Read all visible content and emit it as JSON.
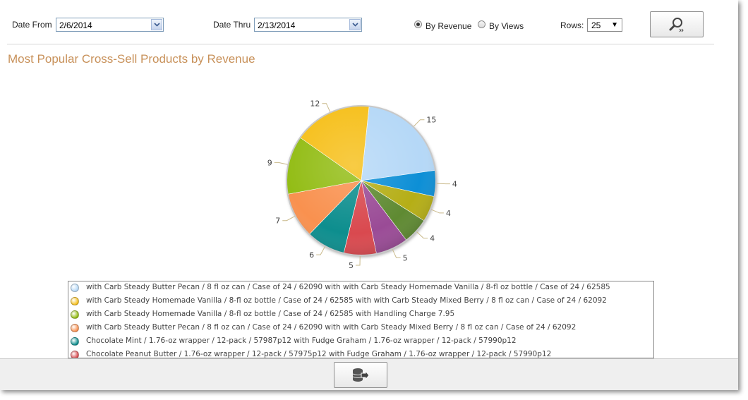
{
  "filters": {
    "date_from_label": "Date From",
    "date_from_value": "2/6/2014",
    "date_thru_label": "Date Thru",
    "date_thru_value": "2/13/2014",
    "by_revenue_label": "By Revenue",
    "by_views_label": "By Views",
    "selected_mode": "By Revenue",
    "rows_label": "Rows:",
    "rows_value": "25"
  },
  "report_title": "Most Popular Cross-Sell Products by Revenue",
  "chart_data": {
    "type": "pie",
    "title": "",
    "values": [
      15,
      4,
      4,
      4,
      5,
      5,
      6,
      7,
      9,
      12
    ],
    "colors": [
      "#b5d8f7",
      "#0f8fd6",
      "#b5ae14",
      "#5f8a31",
      "#9a4c96",
      "#d94a4f",
      "#0e8e8e",
      "#f99150",
      "#93bd12",
      "#f6c01f"
    ],
    "legend": [
      "with Carb Steady Butter Pecan / 8 fl oz can / Case of 24 / 62090 with with Carb Steady Homemade Vanilla / 8-fl oz bottle / Case of 24 / 62585",
      "with Carb Steady Homemade Vanilla / 8-fl oz bottle / Case of 24 / 62585 with with Carb Steady Mixed Berry / 8 fl oz can / Case of 24  / 62092",
      "with Carb Steady Homemade Vanilla / 8-fl oz bottle / Case of 24 / 62585 with Handling Charge 7.95",
      "with Carb Steady Butter Pecan / 8 fl oz can / Case of 24 / 62090 with with Carb Steady Mixed Berry / 8 fl oz can / Case of 24  / 62092",
      "Chocolate Mint / 1.76-oz wrapper / 12-pack / 57987p12 with Fudge Graham / 1.76-oz wrapper / 12-pack / 57990p12",
      "Chocolate Peanut Butter / 1.76-oz wrapper / 12-pack / 57975p12 with Fudge Graham / 1.76-oz wrapper / 12-pack / 57990p12"
    ],
    "legend_colors": [
      "#b5d8f7",
      "#f6c01f",
      "#93bd12",
      "#f99150",
      "#0e8e8e",
      "#d94a4f"
    ]
  },
  "icons": {
    "search_button": "search-icon",
    "export_button": "database-export-icon"
  }
}
